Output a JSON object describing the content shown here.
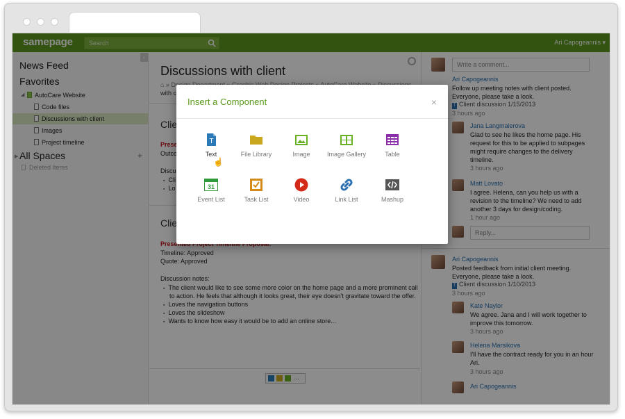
{
  "app": {
    "logo": "samepage",
    "search_placeholder": "Search",
    "user": "Ari Capogeannis"
  },
  "sidebar": {
    "news_feed": "News Feed",
    "favorites": "Favorites",
    "items": [
      {
        "label": "AutoCare Website",
        "selected": false
      },
      {
        "label": "Code files",
        "selected": false
      },
      {
        "label": "Discussions with client",
        "selected": true
      },
      {
        "label": "Images",
        "selected": false
      },
      {
        "label": "Project timeline",
        "selected": false
      }
    ],
    "all_spaces": "All Spaces",
    "deleted": "Deleted Items"
  },
  "content": {
    "title": "Discussions with client",
    "breadcrumb": "⌂  »  Design Department  »  Graphic Web Design Projects  »  AutoCare Website  »  Discussions",
    "subline": "with c",
    "section1_head": "Clie",
    "section1_red": "Presen",
    "section1_outco": "Outco",
    "section1_disc": "Discus",
    "section1_bul1": "Cli",
    "section1_bul2": "Lo",
    "section2_head": "Clie",
    "proposal": "Presented Project Timeline Proposal:",
    "timeline": "Timeline: Approved",
    "quote": "Quote: Approved",
    "notes_label": "Discussion notes:",
    "notes": [
      "The client would like to see some more color on the home page and a more prominent call",
      "to action. He feels that although it looks great, their eye doesn't gravitate toward the offer.",
      "Loves the navigation buttons",
      "Loves the slideshow",
      "Wants to know how easy it would be to add an online store..."
    ]
  },
  "comments": {
    "write_placeholder": "Write a comment...",
    "reply_placeholder": "Reply...",
    "thread1": {
      "author": "Ari Capogeannis",
      "text": "Follow up meeting notes with client posted. Everyone, please take a look.",
      "doc": "Client discussion 1/15/2013",
      "time": "3 hours ago"
    },
    "reply1": {
      "author": "Jana Langmaierova",
      "text": "Glad to see he likes the home page. His request for this to be applied to subpages might require changes to the delivery timeline.",
      "time": "3 hours ago"
    },
    "reply2": {
      "author": "Matt Lovato",
      "text": "I agree. Helena, can you help us with a revision to the timeline? We need to add another 3 days for design/coding.",
      "time": "1 hour ago"
    },
    "thread2": {
      "author": "Ari Capogeannis",
      "text": "Posted feedback from initial client meeting. Everyone, please take a look.",
      "doc": "Client discussion 1/10/2013",
      "time": "3 hours ago"
    },
    "reply3": {
      "author": "Kate Naylor",
      "text": "We agree. Jana and I will work together to improve this tomorrow.",
      "time": "3 hours ago"
    },
    "reply4": {
      "author": "Helena Marsikova",
      "text": "I'll have the contract ready for you in an hour Ari.",
      "time": "3 hours ago"
    },
    "reply5": {
      "author": "Ari Capogeannis"
    }
  },
  "modal": {
    "title": "Insert a Component",
    "close": "×",
    "components": [
      {
        "label": "Text",
        "icon": "text-icon",
        "color": "#2a7ab8"
      },
      {
        "label": "File Library",
        "icon": "folder-icon",
        "color": "#c9a820"
      },
      {
        "label": "Image",
        "icon": "image-icon",
        "color": "#6ab023"
      },
      {
        "label": "Image Gallery",
        "icon": "gallery-icon",
        "color": "#6ab023"
      },
      {
        "label": "Table",
        "icon": "table-icon",
        "color": "#8b2fa8"
      },
      {
        "label": "Event List",
        "icon": "calendar-icon",
        "color": "#2e9a3a"
      },
      {
        "label": "Task List",
        "icon": "checkbox-icon",
        "color": "#d48a16"
      },
      {
        "label": "Video",
        "icon": "play-icon",
        "color": "#d42a1a"
      },
      {
        "label": "Link List",
        "icon": "link-icon",
        "color": "#2a6fb0"
      },
      {
        "label": "Mashup",
        "icon": "code-icon",
        "color": "#555555"
      }
    ],
    "calendar_day": "31"
  }
}
